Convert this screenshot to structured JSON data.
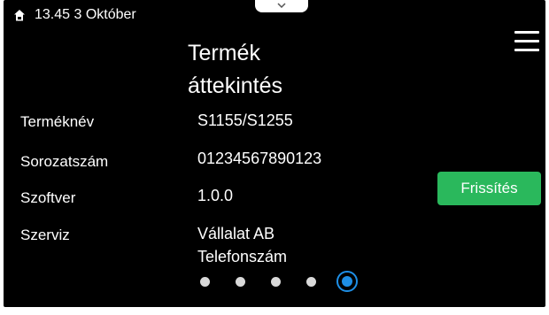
{
  "status_bar": {
    "datetime": "13.45 3 Október",
    "icon": "house-icon"
  },
  "header": {
    "title_line1": "Termék",
    "title_line2": "áttekintés",
    "menu_icon": "hamburger-menu-icon",
    "pull_tab_icon": "chevron-down-icon"
  },
  "product_info": {
    "rows": [
      {
        "label": "Terméknév",
        "value": "S1155/S1255"
      },
      {
        "label": "Sorozatszám",
        "value": "01234567890123"
      },
      {
        "label": "Szoftver",
        "value": "1.0.0"
      },
      {
        "label": "Szerviz",
        "value": "Vállalat AB",
        "value2": "Telefonszám"
      }
    ]
  },
  "actions": {
    "update_label": "Frissítés"
  },
  "pagination": {
    "total_pages": 5,
    "current_page": 5
  },
  "colors": {
    "background": "#000000",
    "accent_button": "#2ab85c",
    "active_page": "#1e8fe6"
  }
}
